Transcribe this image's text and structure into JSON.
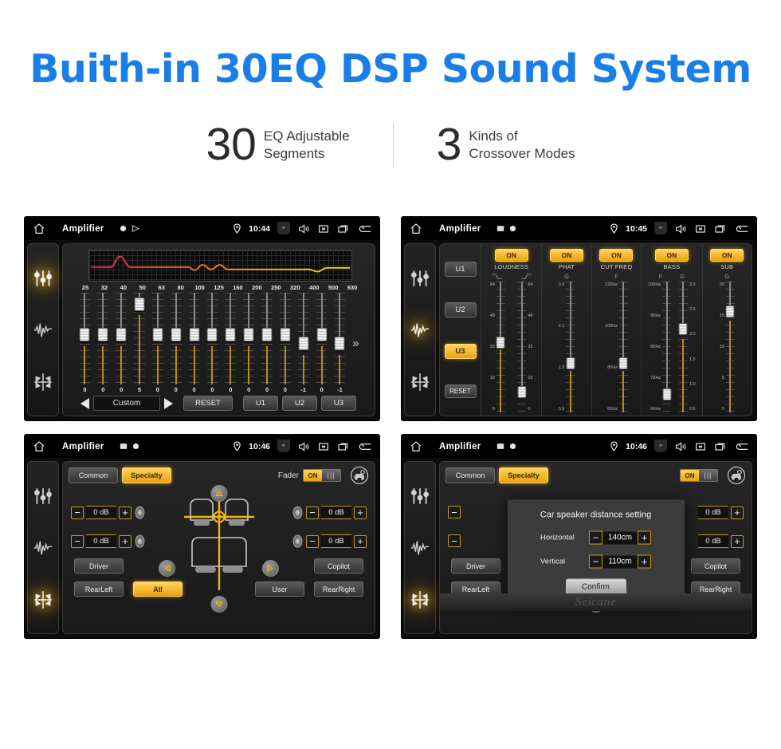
{
  "header": {
    "title": "Buith-in 30EQ DSP Sound System",
    "title_color": "#1a7ee8",
    "stats": [
      {
        "number": "30",
        "text": "EQ Adjustable\nSegments"
      },
      {
        "number": "3",
        "text": "Kinds of\nCrossover Modes"
      }
    ]
  },
  "screens": {
    "eq": {
      "statusbar": {
        "app_title": "Amplifier",
        "time": "10:44"
      },
      "rail_icons": [
        "equalizer-icon",
        "waveform-icon",
        "balance-icon"
      ],
      "active_rail": 0,
      "frequencies": [
        "25",
        "32",
        "40",
        "50",
        "63",
        "80",
        "100",
        "125",
        "160",
        "200",
        "250",
        "320",
        "400",
        "500",
        "630"
      ],
      "values": [
        "0",
        "0",
        "0",
        "5",
        "0",
        "0",
        "0",
        "0",
        "0",
        "0",
        "0",
        "0",
        "-1",
        "0",
        "-1"
      ],
      "preset": "Custom",
      "reset_label": "RESET",
      "user_presets": [
        "U1",
        "U2",
        "U3"
      ],
      "more_label": "»"
    },
    "crossover": {
      "statusbar": {
        "app_title": "Amplifier",
        "time": "10:45"
      },
      "side_presets": [
        "U1",
        "U2",
        "U3"
      ],
      "active_preset": "U3",
      "reset_label": "RESET",
      "columns": [
        {
          "name": "LOUDNESS",
          "state": "ON",
          "units": [
            "curve-low",
            "curve-high"
          ],
          "sliders": [
            {
              "scale": [
                "64",
                "48",
                "32",
                "16",
                "0"
              ],
              "pos": 46
            },
            {
              "scale": [
                "64",
                "48",
                "32",
                "16",
                "0"
              ],
              "pos": 84
            }
          ]
        },
        {
          "name": "PHAT",
          "state": "ON",
          "units": [
            "G"
          ],
          "sliders": [
            {
              "scale": [
                "3.0",
                "2.1",
                "1.3",
                "0.5"
              ],
              "pos": 62
            }
          ]
        },
        {
          "name": "CUT FREQ",
          "state": "ON",
          "units": [
            "F"
          ],
          "sliders": [
            {
              "scale": [
                "120Hz",
                "100Hz",
                "80Hz",
                "60Hz"
              ],
              "pos": 62
            }
          ]
        },
        {
          "name": "BASS",
          "state": "ON",
          "units": [
            "F",
            "G"
          ],
          "sliders": [
            {
              "scale": [
                "100Hz",
                "90Hz",
                "80Hz",
                "70Hz",
                "60Hz"
              ],
              "pos": 88
            },
            {
              "scale": [
                "3.0",
                "2.5",
                "2.0",
                "1.5",
                "1.0",
                "0.5"
              ],
              "pos": 36
            }
          ]
        },
        {
          "name": "SUB",
          "state": "ON",
          "units": [
            "G"
          ],
          "sliders": [
            {
              "scale": [
                "20",
                "15",
                "10",
                "5",
                "0"
              ],
              "pos": 22
            }
          ]
        }
      ]
    },
    "fader": {
      "statusbar": {
        "app_title": "Amplifier",
        "time": "10:46"
      },
      "tabs": [
        {
          "label": "Common",
          "active": false
        },
        {
          "label": "Specialty",
          "active": true
        }
      ],
      "fader_label": "Fader",
      "fader_state": "ON",
      "speakers": [
        {
          "position": "front-left",
          "value": "0 dB"
        },
        {
          "position": "front-right",
          "value": "0 dB"
        },
        {
          "position": "rear-left",
          "value": "0 dB"
        },
        {
          "position": "rear-right",
          "value": "0 dB"
        }
      ],
      "buttons": [
        {
          "label": "Driver",
          "active": false
        },
        {
          "label": "Copilot",
          "active": false
        },
        {
          "label": "RearLeft",
          "active": false
        },
        {
          "label": "All",
          "active": true
        },
        {
          "label": "User",
          "active": false
        },
        {
          "label": "RearRight",
          "active": false
        }
      ]
    },
    "dialog": {
      "statusbar": {
        "app_title": "Amplifier",
        "time": "10:46"
      },
      "tabs": [
        {
          "label": "Common",
          "active": false
        },
        {
          "label": "Specialty",
          "active": true
        }
      ],
      "fader_state": "ON",
      "title": "Car speaker distance setting",
      "rows": [
        {
          "label": "Horizontal",
          "value": "140cm",
          "minus": "−",
          "plus": "+"
        },
        {
          "label": "Vertical",
          "value": "110cm",
          "minus": "−",
          "plus": "+"
        }
      ],
      "confirm_label": "Confirm",
      "buttons": [
        {
          "label": "Driver"
        },
        {
          "label": "Copilot"
        },
        {
          "label": "RearLeft"
        },
        {
          "label": "RearRight"
        }
      ],
      "speaker_values": [
        "0 dB",
        "0 dB"
      ],
      "watermark": "Seicane"
    }
  },
  "colors": {
    "accent_blue": "#1a7ee8",
    "amber": "#eba00d",
    "amber_light": "#ffd45e",
    "screen_bg": "#0c0c0c"
  }
}
